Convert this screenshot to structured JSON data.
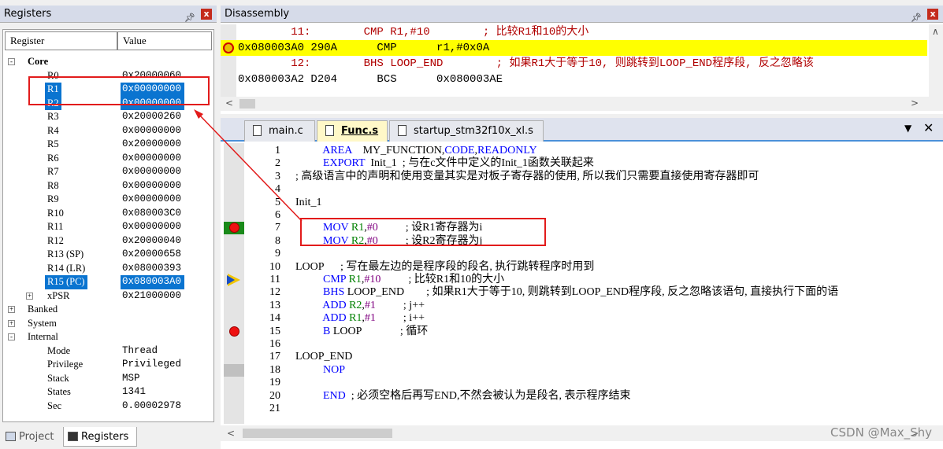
{
  "registers_panel": {
    "title": "Registers",
    "pin_icon": "pin-icon",
    "close_label": "x",
    "col_register": "Register",
    "col_value": "Value",
    "core_label": "Core",
    "core_regs": [
      {
        "name": "R0",
        "value": "0x20000060",
        "selected": false
      },
      {
        "name": "R1",
        "value": "0x00000000",
        "selected": true
      },
      {
        "name": "R2",
        "value": "0x00000000",
        "selected": true
      },
      {
        "name": "R3",
        "value": "0x20000260",
        "selected": false
      },
      {
        "name": "R4",
        "value": "0x00000000",
        "selected": false
      },
      {
        "name": "R5",
        "value": "0x20000000",
        "selected": false
      },
      {
        "name": "R6",
        "value": "0x00000000",
        "selected": false
      },
      {
        "name": "R7",
        "value": "0x00000000",
        "selected": false
      },
      {
        "name": "R8",
        "value": "0x00000000",
        "selected": false
      },
      {
        "name": "R9",
        "value": "0x00000000",
        "selected": false
      },
      {
        "name": "R10",
        "value": "0x080003C0",
        "selected": false
      },
      {
        "name": "R11",
        "value": "0x00000000",
        "selected": false
      },
      {
        "name": "R12",
        "value": "0x20000040",
        "selected": false
      },
      {
        "name": "R13 (SP)",
        "value": "0x20000658",
        "selected": false
      },
      {
        "name": "R14 (LR)",
        "value": "0x08000393",
        "selected": false
      },
      {
        "name": "R15 (PC)",
        "value": "0x080003A0",
        "selected": true
      },
      {
        "name": "xPSR",
        "value": "0x21000000",
        "selected": false
      }
    ],
    "groups": [
      "Banked",
      "System",
      "Internal"
    ],
    "internal": [
      {
        "name": "Mode",
        "value": "Thread"
      },
      {
        "name": "Privilege",
        "value": "Privileged"
      },
      {
        "name": "Stack",
        "value": "MSP"
      },
      {
        "name": "States",
        "value": "1341"
      },
      {
        "name": "Sec",
        "value": "0.00002978"
      }
    ],
    "bottom_tabs": {
      "project": "Project",
      "registers": "Registers"
    }
  },
  "disassembly": {
    "title": "Disassembly",
    "rows": [
      {
        "text": "        11:        CMP R1,#10        ; 比较R1和10的大小",
        "type": "src"
      },
      {
        "text": "0x080003A0 290A      CMP      r1,#0x0A",
        "type": "current"
      },
      {
        "text": "        12:        BHS LOOP_END        ; 如果R1大于等于10, 则跳转到LOOP_END程序段, 反之忽略该",
        "type": "src"
      },
      {
        "text": "0x080003A2 D204      BCS      0x080003AE",
        "type": "asm"
      }
    ]
  },
  "editor": {
    "tabs": [
      "main.c",
      "Func.s",
      "startup_stm32f10x_xl.s"
    ],
    "active_tab": "Func.s",
    "lines": [
      {
        "n": "1",
        "parts": [
          [
            "          ",
            ""
          ],
          [
            "AREA",
            "kw"
          ],
          [
            "    MY_FUNCTION,",
            "cm"
          ],
          [
            "CODE",
            "kw"
          ],
          [
            ",",
            "cm"
          ],
          [
            "READONLY",
            "kw"
          ]
        ]
      },
      {
        "n": "2",
        "parts": [
          [
            "          ",
            ""
          ],
          [
            "EXPORT",
            "kw"
          ],
          [
            "  Init_1  ; 与在c文件中定义的Init_1函数关联起来",
            "cm"
          ]
        ]
      },
      {
        "n": "3",
        "parts": [
          [
            "; 高级语言中的声明和使用变量其实是对板子寄存器的使用, 所以我们只需要直接使用寄存器即可",
            "cm"
          ]
        ]
      },
      {
        "n": "4",
        "parts": []
      },
      {
        "n": "5",
        "parts": [
          [
            "Init_1",
            "cm"
          ]
        ]
      },
      {
        "n": "6",
        "parts": []
      },
      {
        "n": "7",
        "parts": [
          [
            "          ",
            ""
          ],
          [
            "MOV",
            "kw"
          ],
          [
            " ",
            ""
          ],
          [
            "R1",
            "reg"
          ],
          [
            ",",
            ""
          ],
          [
            "#0",
            "num"
          ],
          [
            "          ; 设R1寄存器为i",
            "cm"
          ]
        ]
      },
      {
        "n": "8",
        "parts": [
          [
            "          ",
            ""
          ],
          [
            "MOV",
            "kw"
          ],
          [
            " ",
            ""
          ],
          [
            "R2",
            "reg"
          ],
          [
            ",",
            ""
          ],
          [
            "#0",
            "num"
          ],
          [
            "          ; 设R2寄存器为j",
            "cm"
          ]
        ]
      },
      {
        "n": "9",
        "parts": []
      },
      {
        "n": "10",
        "parts": [
          [
            "LOOP      ; 写在最左边的是程序段的段名, 执行跳转程序时用到",
            "cm"
          ]
        ]
      },
      {
        "n": "11",
        "parts": [
          [
            "          ",
            ""
          ],
          [
            "CMP",
            "kw"
          ],
          [
            " ",
            ""
          ],
          [
            "R1",
            "reg"
          ],
          [
            ",",
            ""
          ],
          [
            "#10",
            "num"
          ],
          [
            "          ; 比较R1和10的大小",
            "cm"
          ]
        ]
      },
      {
        "n": "12",
        "parts": [
          [
            "          ",
            ""
          ],
          [
            "BHS",
            "kw"
          ],
          [
            " LOOP_END        ; 如果R1大于等于10, 则跳转到LOOP_END程序段, 反之忽略该语句, 直接执行下面的语",
            "cm"
          ]
        ]
      },
      {
        "n": "13",
        "parts": [
          [
            "          ",
            ""
          ],
          [
            "ADD",
            "kw"
          ],
          [
            " ",
            ""
          ],
          [
            "R2",
            "reg"
          ],
          [
            ",",
            ""
          ],
          [
            "#1",
            "num"
          ],
          [
            "          ; j++",
            "cm"
          ]
        ]
      },
      {
        "n": "14",
        "parts": [
          [
            "          ",
            ""
          ],
          [
            "ADD",
            "kw"
          ],
          [
            " ",
            ""
          ],
          [
            "R1",
            "reg"
          ],
          [
            ",",
            ""
          ],
          [
            "#1",
            "num"
          ],
          [
            "          ; i++",
            "cm"
          ]
        ]
      },
      {
        "n": "15",
        "parts": [
          [
            "          ",
            ""
          ],
          [
            "B",
            "kw"
          ],
          [
            " LOOP              ; 循环",
            "cm"
          ]
        ]
      },
      {
        "n": "16",
        "parts": []
      },
      {
        "n": "17",
        "parts": [
          [
            "LOOP_END",
            "cm"
          ]
        ]
      },
      {
        "n": "18",
        "parts": [
          [
            "          ",
            ""
          ],
          [
            "NOP",
            "kw"
          ]
        ]
      },
      {
        "n": "19",
        "parts": []
      },
      {
        "n": "20",
        "parts": [
          [
            "          ",
            ""
          ],
          [
            "END",
            "kw"
          ],
          [
            "  ; 必须空格后再写END,不然会被认为是段名, 表示程序结束",
            "cm"
          ]
        ]
      },
      {
        "n": "21",
        "parts": []
      }
    ],
    "breakpoints": [
      "7",
      "15"
    ],
    "current_line": "11",
    "watermark": "CSDN @Max_Shy"
  }
}
